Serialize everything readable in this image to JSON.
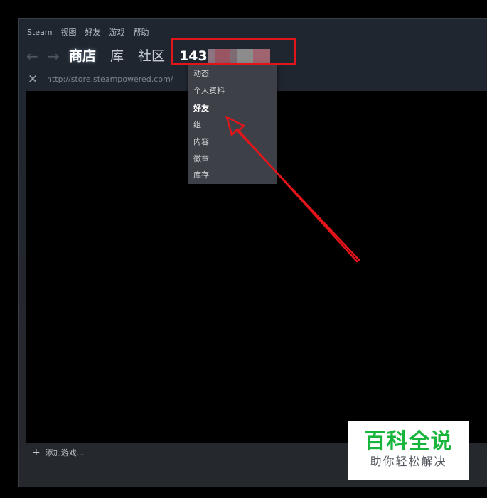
{
  "menubar": {
    "items": [
      "Steam",
      "视图",
      "好友",
      "游戏",
      "帮助"
    ]
  },
  "navbar": {
    "back_icon": "arrow-left-icon",
    "forward_icon": "arrow-right-icon",
    "store": "商店",
    "library": "库",
    "community": "社区",
    "user_prefix": "143"
  },
  "urlbar": {
    "close_icon": "close-icon",
    "url": "http://store.steampowered.com/"
  },
  "dropdown": {
    "items": [
      "动态",
      "个人资料",
      "好友",
      "组",
      "内容",
      "徽章",
      "库存"
    ],
    "selected_index": 2
  },
  "footer": {
    "add_game_icon": "plus-icon",
    "add_game": "添加游戏..."
  },
  "watermark": {
    "title": "百科全说",
    "subtitle": "助你轻松解决"
  },
  "colors": {
    "highlight_box": "#e3151a",
    "arrow": "#e3151a",
    "watermark_green": "#18b53c"
  }
}
